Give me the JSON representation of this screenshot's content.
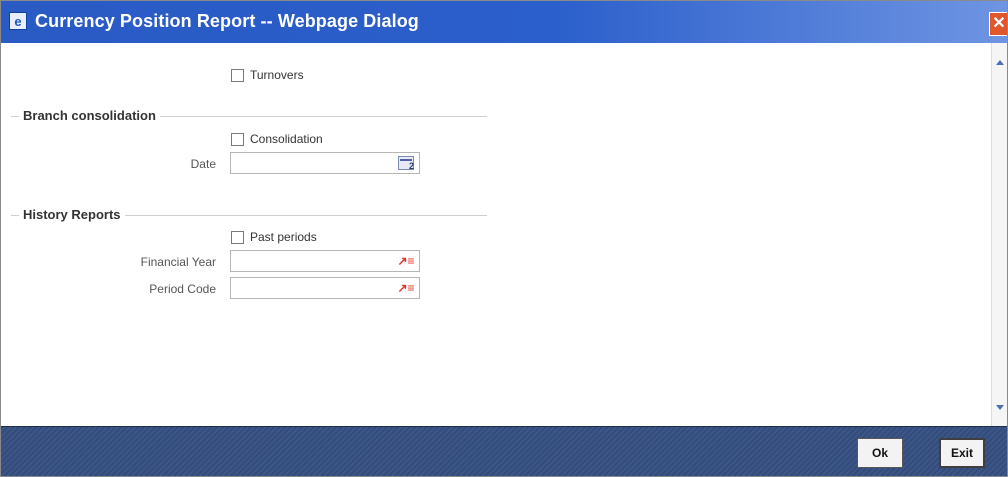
{
  "window": {
    "title": "Currency Position Report -- Webpage Dialog",
    "icon": "e-icon",
    "close_icon": "close-icon",
    "colors": {
      "title_bar": "#2b5fcb",
      "close_button": "#e0562d",
      "footer": "#344c79"
    }
  },
  "form": {
    "turnovers_label": "Turnovers",
    "branch_consolidation": {
      "section_title": "Branch consolidation",
      "consolidation_label": "Consolidation",
      "date_label": "Date",
      "date_value": "",
      "date_icon": "calendar-icon"
    },
    "history_reports": {
      "section_title": "History Reports",
      "past_periods_label": "Past periods",
      "financial_year_label": "Financial Year",
      "financial_year_value": "",
      "period_code_label": "Period Code",
      "period_code_value": "",
      "lov_icon": "list-of-values-icon"
    }
  },
  "footer": {
    "ok_label": "Ok",
    "exit_label": "Exit"
  }
}
